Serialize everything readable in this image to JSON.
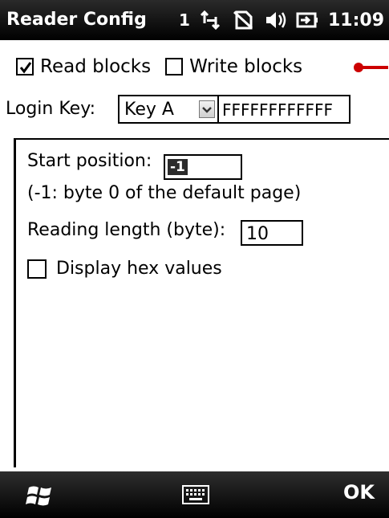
{
  "titlebar": {
    "title": "Reader Config",
    "signal": "1",
    "time": "11:09",
    "icons": [
      "data-sync-icon",
      "no-sim-icon",
      "speaker-icon",
      "battery-charging-icon"
    ]
  },
  "options": {
    "read_blocks": {
      "label": "Read blocks",
      "checked": true
    },
    "write_blocks": {
      "label": "Write blocks",
      "checked": false
    }
  },
  "login": {
    "label": "Login Key:",
    "key_type": "Key A",
    "key_value": "FFFFFFFFFFFF"
  },
  "panel": {
    "start_label": "Start position:",
    "start_value": "-1",
    "start_hint": "(-1: byte 0 of the default page)",
    "length_label": "Reading length (byte):",
    "length_value": "10",
    "hex_label": "Display hex values",
    "hex_checked": false
  },
  "bottombar": {
    "ok_label": "OK",
    "icons": [
      "windows-start-icon",
      "keyboard-icon"
    ]
  },
  "colors": {
    "bar_background": "#000000",
    "indicator": "#cc0000"
  }
}
